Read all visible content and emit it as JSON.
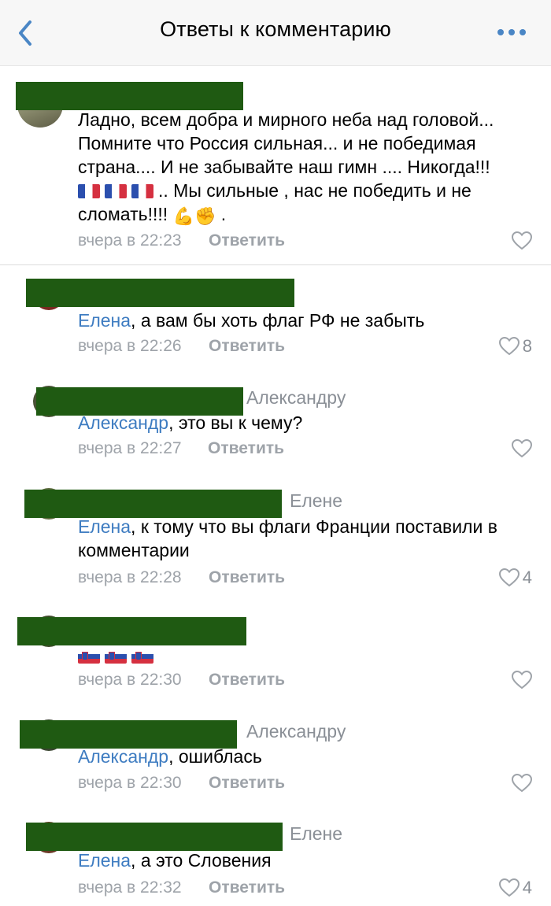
{
  "header": {
    "title": "Ответы к комментарию",
    "back_icon": "chevron-left-icon",
    "more_icon": "more-horizontal-icon",
    "accent_color": "#4a86c5"
  },
  "comments": [
    {
      "text_before": "Ладно, всем добра и мирного неба над головой... Помните что Россия сильная... и не победимая страна.... И не забывайте наш гимн .... Никогда!!!",
      "text_after_flags": ".. Мы сильные , нас не победить и не сломать!!!!",
      "emoji": "💪✊",
      "time": "вчера в 22:23",
      "reply_label": "Ответить",
      "likes": ""
    },
    {
      "mention": "Елена",
      "text": ", а вам бы хоть флаг РФ не забыть",
      "time": "вчера в 22:26",
      "reply_label": "Ответить",
      "likes": "8"
    },
    {
      "reply_to": "Александру",
      "mention": "Александр",
      "text": ", это вы к чему?",
      "time": "вчера в 22:27",
      "reply_label": "Ответить",
      "likes": ""
    },
    {
      "reply_to": "Елене",
      "mention": "Елена",
      "text": ", к тому что вы флаги Франции поставили в комментарии",
      "time": "вчера в 22:28",
      "reply_label": "Ответить",
      "likes": "4"
    },
    {
      "time": "вчера в 22:30",
      "reply_label": "Ответить",
      "likes": ""
    },
    {
      "reply_to": "Александру",
      "mention": "Александр",
      "text": ", ошиблась",
      "time": "вчера в 22:30",
      "reply_label": "Ответить",
      "likes": ""
    },
    {
      "reply_to": "Елене",
      "mention": "Елена",
      "text": ", а это Словения",
      "time": "вчера в 22:32",
      "reply_label": "Ответить",
      "likes": "4"
    }
  ]
}
